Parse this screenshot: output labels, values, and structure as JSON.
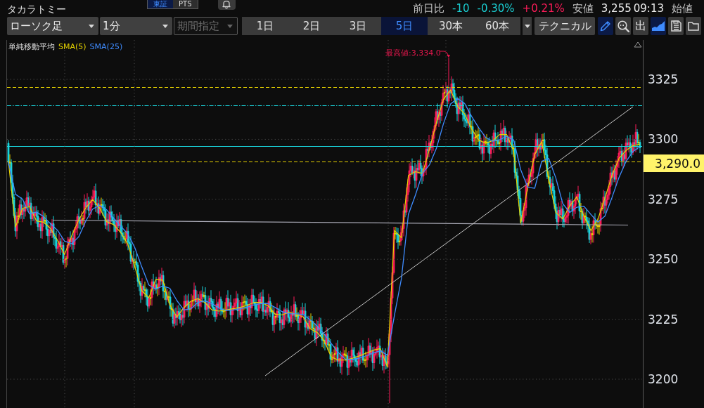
{
  "header": {
    "title": "タカラトミー",
    "markets": [
      {
        "label": "東証",
        "selected": true
      },
      {
        "label": "PTS",
        "selected": false
      }
    ],
    "quote": [
      {
        "kind": "label",
        "text": "前日比"
      },
      {
        "kind": "down",
        "text": "-10"
      },
      {
        "kind": "down",
        "text": "-0.30%"
      },
      {
        "kind": "up",
        "text": "+0.21%"
      },
      {
        "kind": "label",
        "text": "安値"
      },
      {
        "kind": "value",
        "text": "3,255"
      },
      {
        "kind": "time",
        "text": "09:13"
      },
      {
        "kind": "label",
        "text": "始値"
      }
    ]
  },
  "toolbar": {
    "chart_type": "ローソク足",
    "interval": "1分",
    "period": {
      "label": "期間指定",
      "disabled": true
    },
    "ranges": [
      {
        "label": "1日",
        "selected": false
      },
      {
        "label": "2日",
        "selected": false
      },
      {
        "label": "3日",
        "selected": false
      },
      {
        "label": "5日",
        "selected": true
      },
      {
        "label": "30本",
        "selected": false
      },
      {
        "label": "60本",
        "selected": false
      }
    ],
    "technical": "テクニカル",
    "tools": [
      {
        "kind": "pencil",
        "on": true
      },
      {
        "kind": "zoom",
        "on": false
      },
      {
        "kind": "text",
        "label": "出",
        "on": false
      },
      {
        "kind": "area",
        "on": true
      },
      {
        "kind": "save",
        "on": false
      },
      {
        "kind": "folder",
        "on": false
      }
    ]
  },
  "chart": {
    "legend_title": "単純移動平均",
    "high_note": "最高値:3,334.0",
    "current_price": "3,290.0",
    "chart_data": {
      "type": "line",
      "grid": true,
      "ylim": [
        3188,
        3341.4
      ],
      "yticks": [
        3325,
        3300,
        3275,
        3250,
        3225,
        3200
      ],
      "series": [
        {
          "name": "SMA(5)",
          "color": "#e6d200",
          "values": [
            3290.7,
            3263.5,
            3271.2,
            3272.0,
            3266.0,
            3265.5,
            3262.8,
            3257.9,
            3252.0,
            3259.7,
            3266.3,
            3271.4,
            3274.9,
            3271.3,
            3265.7,
            3264.4,
            3261.2,
            3256.4,
            3247.0,
            3236.9,
            3234.0,
            3241.5,
            3241.3,
            3231.0,
            3226.0,
            3229.8,
            3232.5,
            3233.6,
            3231.9,
            3228.9,
            3228.4,
            3228.9,
            3229.4,
            3229.9,
            3230.8,
            3232.0,
            3232.0,
            3230.6,
            3227.1,
            3226.8,
            3228.0,
            3227.0,
            3226.0,
            3221.0,
            3219.5,
            3216.0,
            3209.3,
            3208.0,
            3208.0,
            3208.7,
            3209.7,
            3210.9,
            3212.1,
            3212.8,
            3205.0,
            3262.0,
            3259.0,
            3285.0,
            3286.5,
            3285.8,
            3296.0,
            3307.0,
            3316.7,
            3320.6,
            3313.8,
            3310.6,
            3304.4,
            3299.8,
            3298.3,
            3299.5,
            3302.0,
            3302.0,
            3295.0,
            3265.0,
            3280.0,
            3293.7,
            3299.0,
            3283.3,
            3269.5,
            3266.8,
            3272.3,
            3276.0,
            3268.0,
            3262.0,
            3266.6,
            3275.5,
            3284.9,
            3292.0,
            3295.3,
            3297.4,
            3298.0
          ]
        },
        {
          "name": "SMA(25)",
          "color": "#3f8cff",
          "values": [
            3290.7,
            3277.1,
            3275.1,
            3268.9,
            3269.7,
            3267.8,
            3264.8,
            3262.1,
            3257.6,
            3256.5,
            3259.3,
            3265.8,
            3270.9,
            3272.5,
            3270.6,
            3267.1,
            3263.8,
            3260.7,
            3254.9,
            3246.8,
            3239.3,
            3237.5,
            3238.9,
            3237.9,
            3232.8,
            3228.9,
            3229.4,
            3232.0,
            3232.7,
            3231.5,
            3229.7,
            3228.7,
            3228.9,
            3229.4,
            3230.0,
            3230.9,
            3231.6,
            3231.5,
            3229.9,
            3228.2,
            3227.3,
            3227.3,
            3227.0,
            3224.7,
            3222.2,
            3218.8,
            3214.9,
            3211.1,
            3208.4,
            3208.2,
            3208.8,
            3209.8,
            3210.9,
            3211.9,
            3210.0,
            3226.6,
            3242.0,
            3268.7,
            3276.8,
            3285.8,
            3289.4,
            3296.3,
            3306.6,
            3314.8,
            3317.0,
            3315.0,
            3309.6,
            3304.9,
            3300.8,
            3299.2,
            3299.9,
            3301.2,
            3299.7,
            3287.3,
            3280.0,
            3279.6,
            3290.9,
            3292.0,
            3283.9,
            3273.2,
            3269.5,
            3271.7,
            3272.1,
            3268.7,
            3265.5,
            3268.0,
            3275.7,
            3284.1,
            3290.7,
            3294.9,
            3296.9
          ]
        }
      ]
    }
  }
}
